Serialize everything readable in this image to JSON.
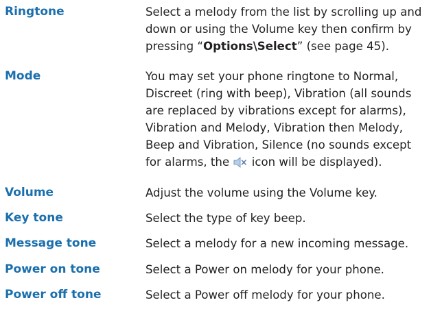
{
  "entries": [
    {
      "term": "Ringtone",
      "desc": {
        "line1": "Select a melody from the list by scrolling up and",
        "line2": "down or using the Volume key then confirm by",
        "line3_pre": "pressing “",
        "line3_bold": "Options\\Select",
        "line3_post": "” (see page 45)."
      }
    },
    {
      "term": "Mode",
      "desc": {
        "line1": "You may set your phone ringtone to Normal,",
        "line2": "Discreet (ring with beep), Vibration (all sounds",
        "line3": "are replaced by vibrations except for alarms),",
        "line4": "Vibration and Melody, Vibration then Melody,",
        "line5": "Beep and Vibration, Silence (no sounds except",
        "line6_pre": "for alarms, the ",
        "line6_post": " icon will be displayed)."
      }
    },
    {
      "term": "Volume",
      "desc": "Adjust the volume using the Volume key."
    },
    {
      "term": "Key tone",
      "desc": "Select the type of key beep."
    },
    {
      "term": "Message tone",
      "desc": "Select a melody for a new incoming message."
    },
    {
      "term": "Power on tone",
      "desc": "Select a Power on melody for your phone."
    },
    {
      "term": "Power off tone",
      "desc": "Select a Power off melody for your phone."
    }
  ],
  "icons": {
    "silence_icon": "silent-speaker-icon"
  },
  "colors": {
    "term": "#1a6fad",
    "body_text": "#231f20",
    "background": "#ffffff"
  }
}
